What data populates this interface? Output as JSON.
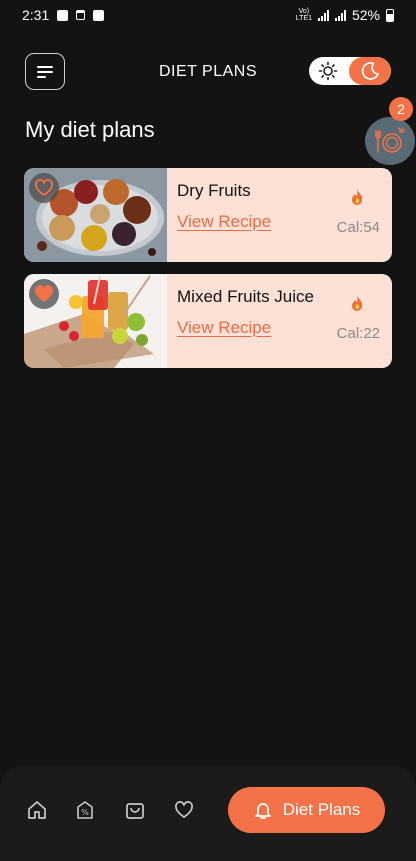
{
  "status_bar": {
    "time": "2:31",
    "volte": "Vo)\nLTE1",
    "battery": "52%"
  },
  "header": {
    "title": "DIET PLANS",
    "menu_icon": "hamburger-menu-icon",
    "theme_toggle": {
      "light_icon": "sun-icon",
      "dark_icon": "moon-icon",
      "selected": "dark"
    }
  },
  "section": {
    "title": "My diet plans"
  },
  "plan_fab": {
    "icon": "fork-knife-plate-icon",
    "badge": "2"
  },
  "plans": [
    {
      "name": "Dry Fruits",
      "link": "View Recipe",
      "calories": "Cal:54",
      "favorite": false,
      "image": "dry-fruits-platter"
    },
    {
      "name": "Mixed Fruits Juice",
      "link": "View Recipe",
      "calories": "Cal:22",
      "favorite": true,
      "image": "fruit-juice-glasses"
    }
  ],
  "bottom_nav": {
    "items": [
      {
        "icon": "home-icon"
      },
      {
        "icon": "discount-tag-icon"
      },
      {
        "icon": "shopping-bag-icon"
      },
      {
        "icon": "heart-icon"
      }
    ],
    "active": {
      "icon": "bell-icon",
      "label": "Diet Plans"
    }
  },
  "colors": {
    "background": "#131313",
    "accent": "#f47247",
    "card": "#fde1d7",
    "link": "#f06b42"
  }
}
